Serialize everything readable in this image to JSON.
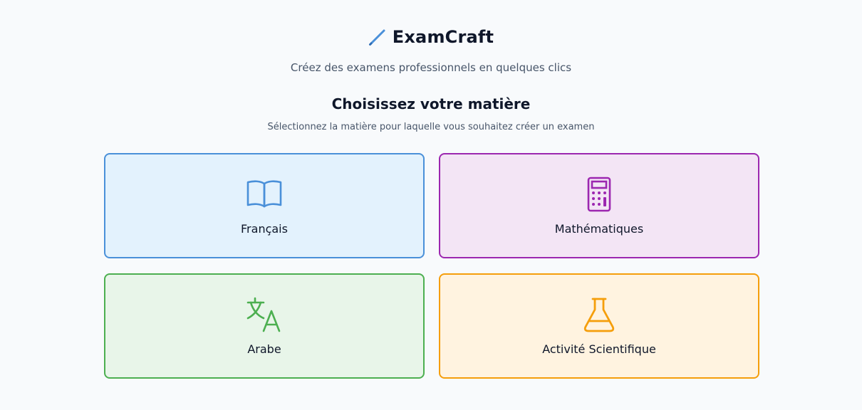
{
  "app": {
    "title": "ExamCraft",
    "tagline": "Créez des examens professionnels en quelques clics",
    "logo_icon": "pencil-icon"
  },
  "main": {
    "heading": "Choisissez votre matière",
    "subheading": "Sélectionnez la matière pour laquelle vous souhaitez créer un examen",
    "subjects": [
      {
        "label": "Français",
        "icon": "book-icon",
        "color": "#4a90d9",
        "background": "#e3f2fd"
      },
      {
        "label": "Mathématiques",
        "icon": "calculator-icon",
        "color": "#9c27b0",
        "background": "#f3e5f5"
      },
      {
        "label": "Arabe",
        "icon": "translate-icon",
        "color": "#4caf50",
        "background": "#e8f5e9"
      },
      {
        "label": "Activité Scientifique",
        "icon": "flask-icon",
        "color": "#f59e0b",
        "background": "#fff3e0"
      }
    ]
  },
  "colors": {
    "accent": "#4a90d9",
    "background": "#f8fafc",
    "text": "#0f172a",
    "muted": "#475569"
  }
}
